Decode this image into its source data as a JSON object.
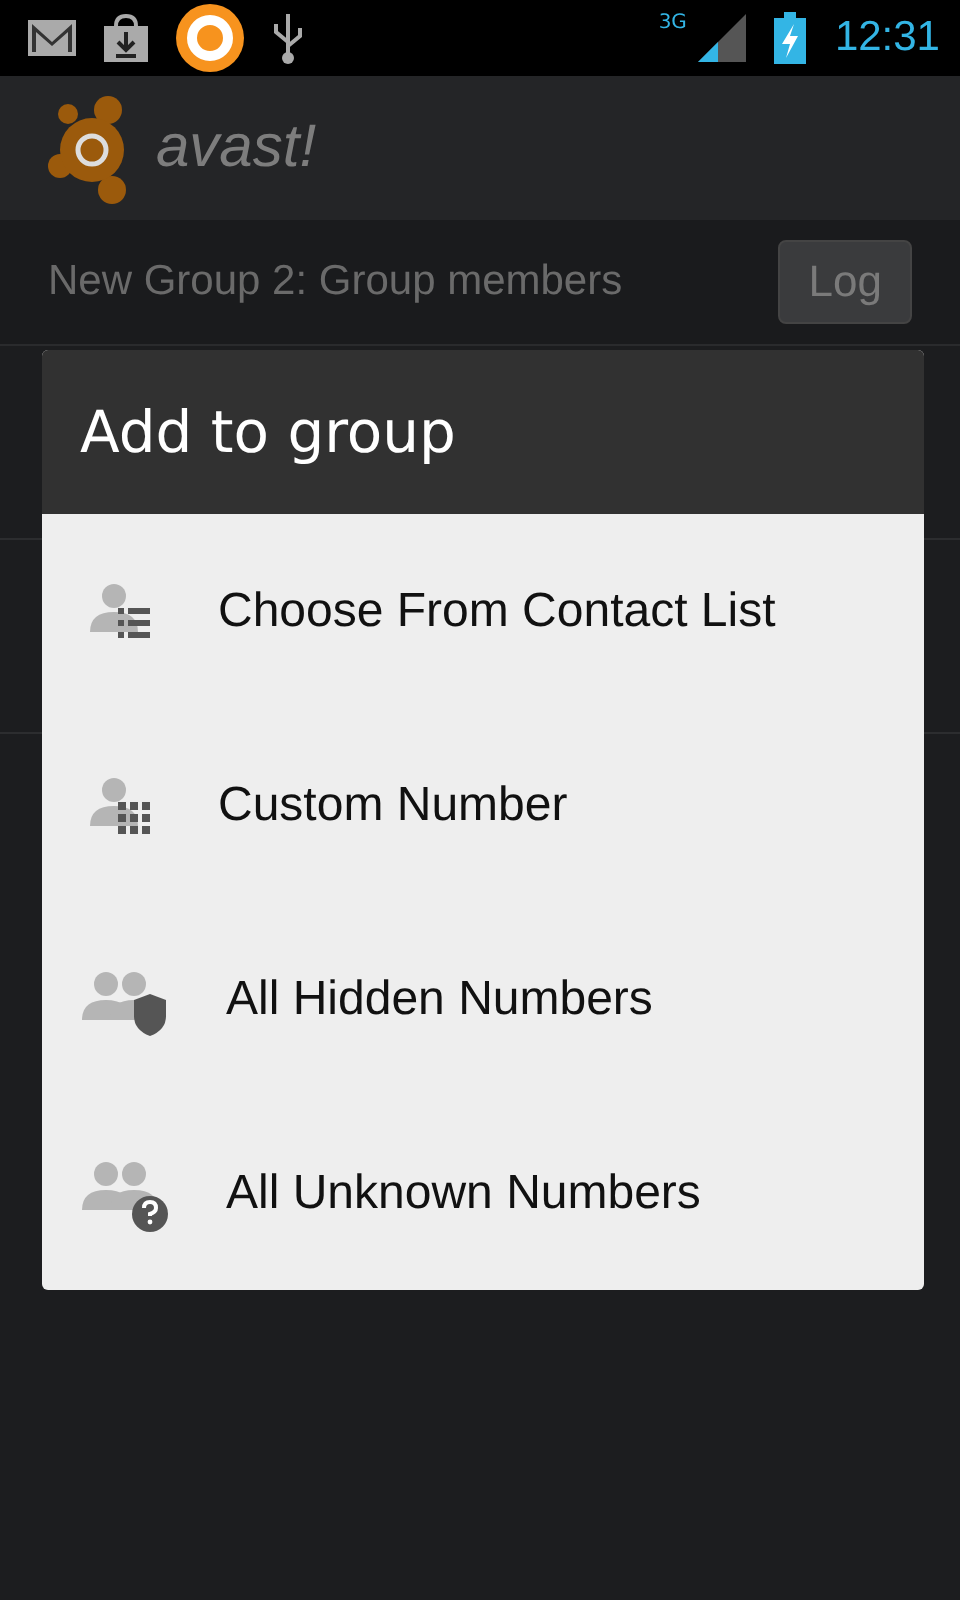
{
  "status_bar": {
    "network": "3G",
    "time": "12:31"
  },
  "app_header": {
    "logo_text": "avast!"
  },
  "title_bar": {
    "title": "New Group 2: Group members",
    "button": "Log"
  },
  "dialog": {
    "title": "Add to group",
    "items": [
      {
        "label": "Choose From Contact List",
        "kind": "list"
      },
      {
        "label": "Custom Number",
        "kind": "dialpad"
      },
      {
        "label": "All Hidden Numbers",
        "kind": "shield"
      },
      {
        "label": "All Unknown Numbers",
        "kind": "question"
      }
    ]
  }
}
